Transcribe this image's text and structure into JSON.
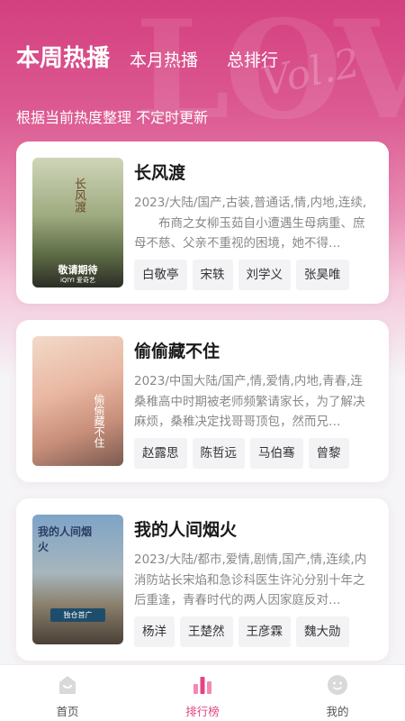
{
  "header": {
    "tabs": [
      {
        "label": "本周热播",
        "active": true
      },
      {
        "label": "本月热播",
        "active": false
      },
      {
        "label": "总排行",
        "active": false
      }
    ],
    "subtitle": "根据当前热度整理 不定时更新"
  },
  "shows": [
    {
      "title": "长风渡",
      "meta": "2023/大陆/国产,古装,普通话,情,内地,连续,",
      "desc": "　　布商之女柳玉茹自小遭遇生母病重、庶母不慈、父亲不重视的困境，她不得…",
      "cast": [
        "白敬亭",
        "宋轶",
        "刘学义",
        "张昊唯"
      ],
      "poster_text": {
        "title": "长风渡",
        "tagline": "敬请期待",
        "brand": "iQIYI 爱奇艺"
      }
    },
    {
      "title": "偷偷藏不住",
      "meta": "2023/中国大陆/国产,情,爱情,内地,青春,连",
      "desc": "桑稚高中时期被老师频繁请家长，为了解决麻烦，桑稚决定找哥哥顶包，然而兄…",
      "cast": [
        "赵露思",
        "陈哲远",
        "马伯骞",
        "曾黎"
      ],
      "poster_text": {
        "title": "偷偷藏不住"
      }
    },
    {
      "title": "我的人间烟火",
      "meta": "2023/大陆/都市,爱情,剧情,国产,情,连续,内",
      "desc": "消防站长宋焰和急诊科医生许沁分别十年之后重逢，青春时代的两人因家庭反对…",
      "cast": [
        "杨洋",
        "王楚然",
        "王彦霖",
        "魏大勋"
      ],
      "poster_text": {
        "title": "我的人间烟火",
        "badge": "独仓首广"
      }
    }
  ],
  "bottom_nav": [
    {
      "label": "首页",
      "icon": "home-icon",
      "active": false
    },
    {
      "label": "排行榜",
      "icon": "bar-chart-icon",
      "active": true
    },
    {
      "label": "我的",
      "icon": "profile-icon",
      "active": false
    }
  ],
  "colors": {
    "accent": "#e04586",
    "header_gradient_top": "#d43f7f",
    "background": "#f5f4f7"
  }
}
